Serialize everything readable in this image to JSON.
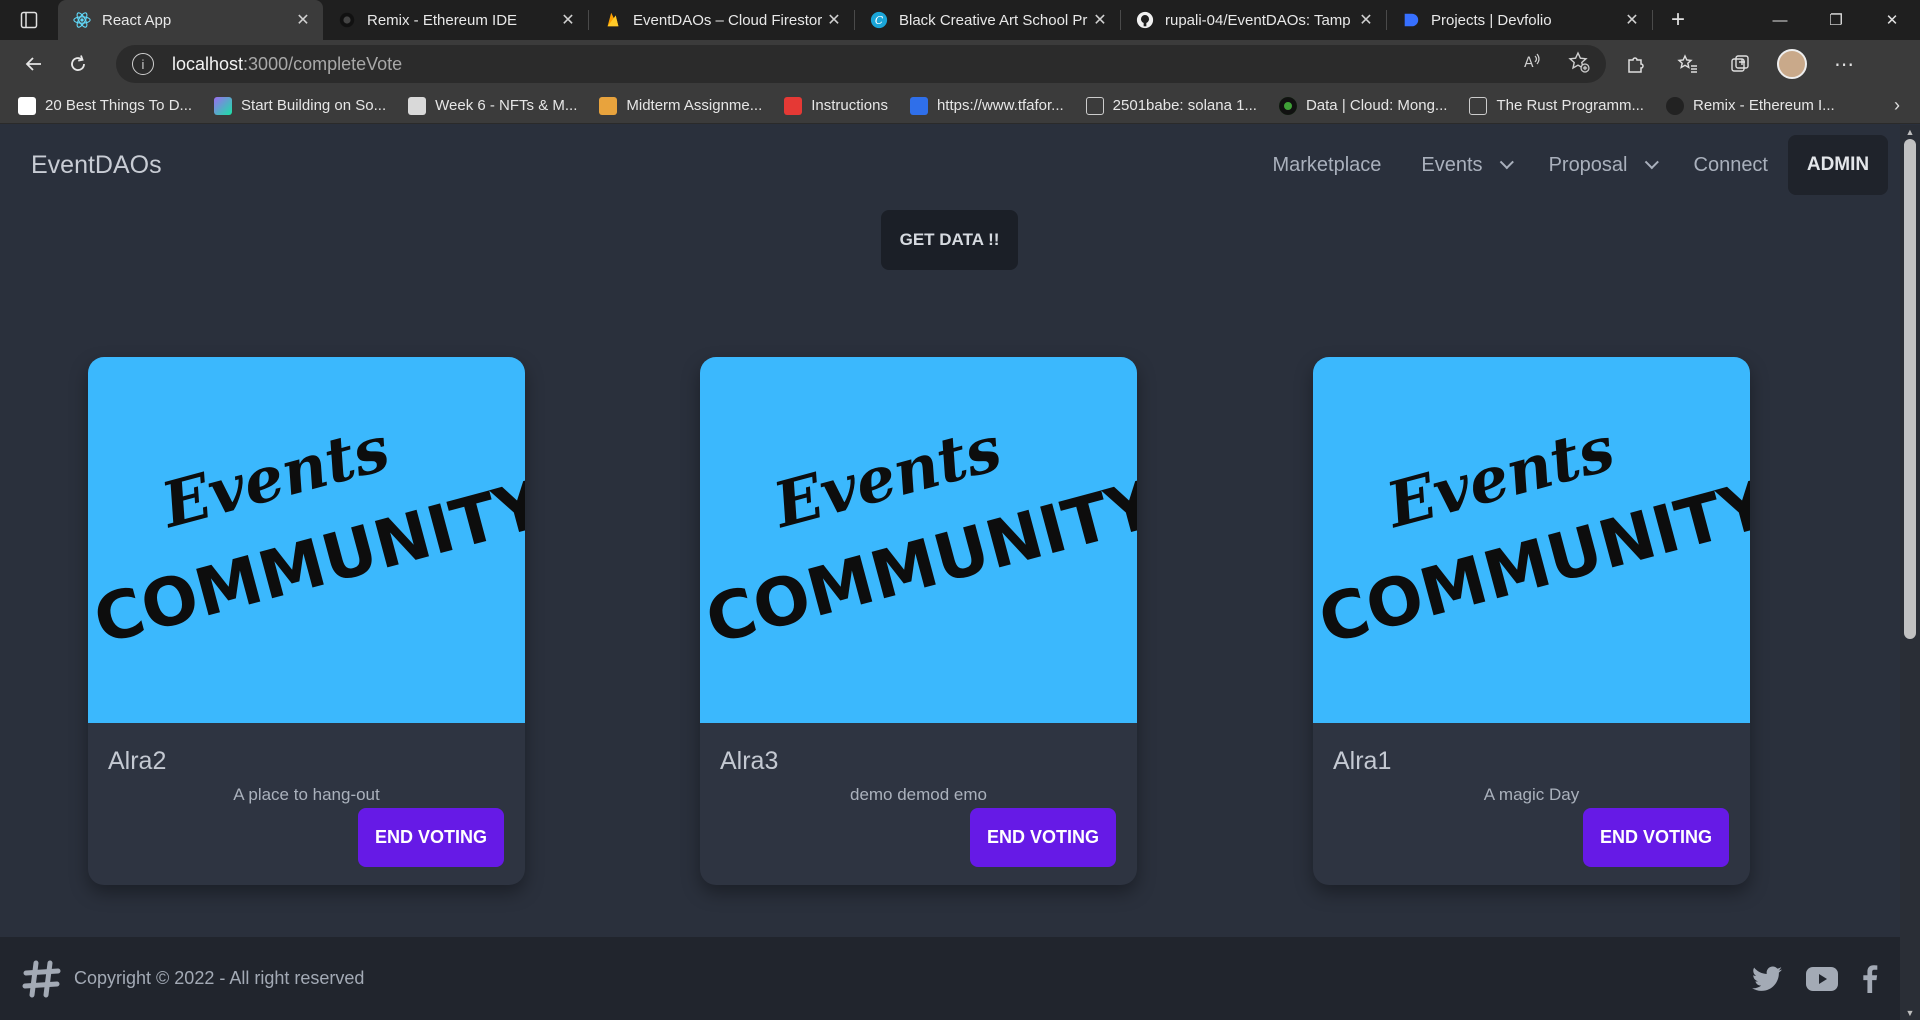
{
  "browser": {
    "tabs": [
      {
        "title": "React App",
        "active": true
      },
      {
        "title": "Remix - Ethereum IDE",
        "active": false
      },
      {
        "title": "EventDAOs – Cloud Firestor",
        "active": false
      },
      {
        "title": "Black Creative Art School Pr",
        "active": false
      },
      {
        "title": "rupali-04/EventDAOs: Tamp",
        "active": false
      },
      {
        "title": "Projects | Devfolio",
        "active": false
      }
    ],
    "url_host": "localhost",
    "url_path": ":3000/completeVote",
    "bookmarks": [
      {
        "label": "20 Best Things To D...",
        "color": "#ffffff"
      },
      {
        "label": "Start Building on So...",
        "color": "#9b6cf0"
      },
      {
        "label": "Week 6 - NFTs & M...",
        "color": "#d9d9d9"
      },
      {
        "label": "Midterm Assignme...",
        "color": "#e8a33d"
      },
      {
        "label": "Instructions",
        "color": "#e53935"
      },
      {
        "label": "https://www.tfafor...",
        "color": "#2f6fea"
      },
      {
        "label": "2501babe: solana 1...",
        "color": "#cccccc"
      },
      {
        "label": "Data | Cloud: Mong...",
        "color": "#3fa037"
      },
      {
        "label": "The Rust Programm...",
        "color": "#cccccc"
      },
      {
        "label": "Remix - Ethereum I...",
        "color": "#222222"
      }
    ]
  },
  "app": {
    "brand": "EventDAOs",
    "nav": {
      "marketplace": "Marketplace",
      "events": "Events",
      "proposal": "Proposal",
      "connect": "Connect",
      "admin": "ADMIN"
    },
    "get_data_label": "GET DATA !!",
    "art": {
      "script_word": "Events",
      "block_word": "COMMUNITY"
    },
    "cards": [
      {
        "name": "Alra2",
        "description": "A place to hang-out",
        "button": "END VOTING"
      },
      {
        "name": "Alra3",
        "description": "demo demod emo",
        "button": "END VOTING"
      },
      {
        "name": "Alra1",
        "description": "A magic Day",
        "button": "END VOTING"
      }
    ],
    "footer": {
      "copyright": "Copyright © 2022 - All right reserved"
    },
    "colors": {
      "accent": "#661ae6",
      "art_bg": "#3bb8fd",
      "page_bg": "#2a303c"
    }
  }
}
